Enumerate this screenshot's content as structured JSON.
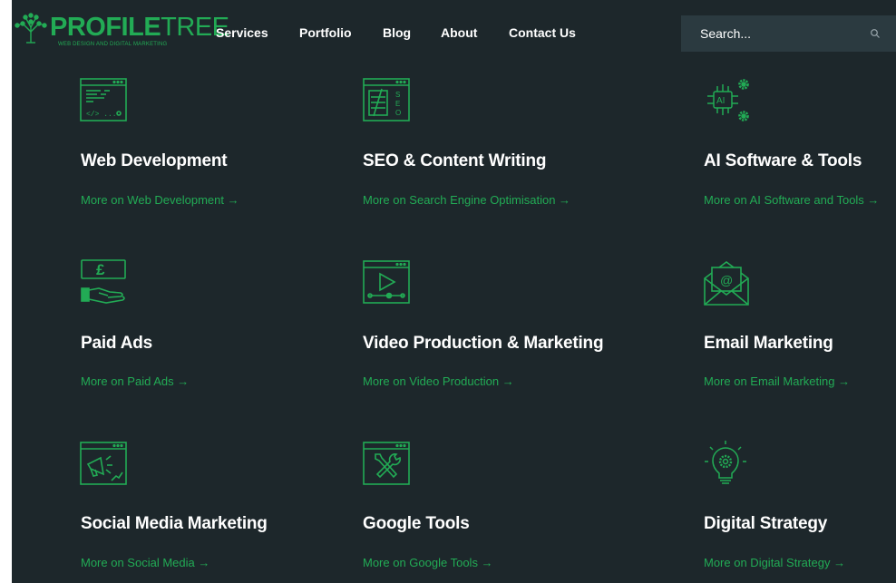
{
  "brand": {
    "name_part1": "PROFILE",
    "name_part2": "TREE",
    "tagline": "WEB DESIGN AND DIGITAL MARKETING",
    "green": "#22ab55",
    "background": "#1d272b"
  },
  "nav": {
    "items": [
      {
        "label": "Services"
      },
      {
        "label": "Portfolio"
      },
      {
        "label": "Blog"
      },
      {
        "label": "About"
      },
      {
        "label": "Contact Us"
      }
    ]
  },
  "search": {
    "placeholder": "Search...",
    "icon": "search-icon"
  },
  "services": [
    {
      "icon": "web-development-icon",
      "title": "Web Development",
      "link": "More on Web Development →"
    },
    {
      "icon": "seo-icon",
      "title": "SEO & Content Writing",
      "link": "More on Search Engine Optimisation →"
    },
    {
      "icon": "ai-chip-icon",
      "title": "AI Software & Tools",
      "link": "More on AI Software and Tools →"
    },
    {
      "icon": "paid-ads-icon",
      "title": "Paid Ads",
      "link": "More on Paid Ads →"
    },
    {
      "icon": "video-production-icon",
      "title": "Video Production & Marketing",
      "link": "More on Video Production →"
    },
    {
      "icon": "email-marketing-icon",
      "title": "Email Marketing",
      "link": "More on Email Marketing →"
    },
    {
      "icon": "social-media-icon",
      "title": "Social Media Marketing",
      "link": "More on Social Media →"
    },
    {
      "icon": "google-tools-icon",
      "title": "Google Tools",
      "link": "More on Google Tools →"
    },
    {
      "icon": "digital-strategy-icon",
      "title": "Digital Strategy",
      "link": "More on Digital Strategy →"
    }
  ]
}
